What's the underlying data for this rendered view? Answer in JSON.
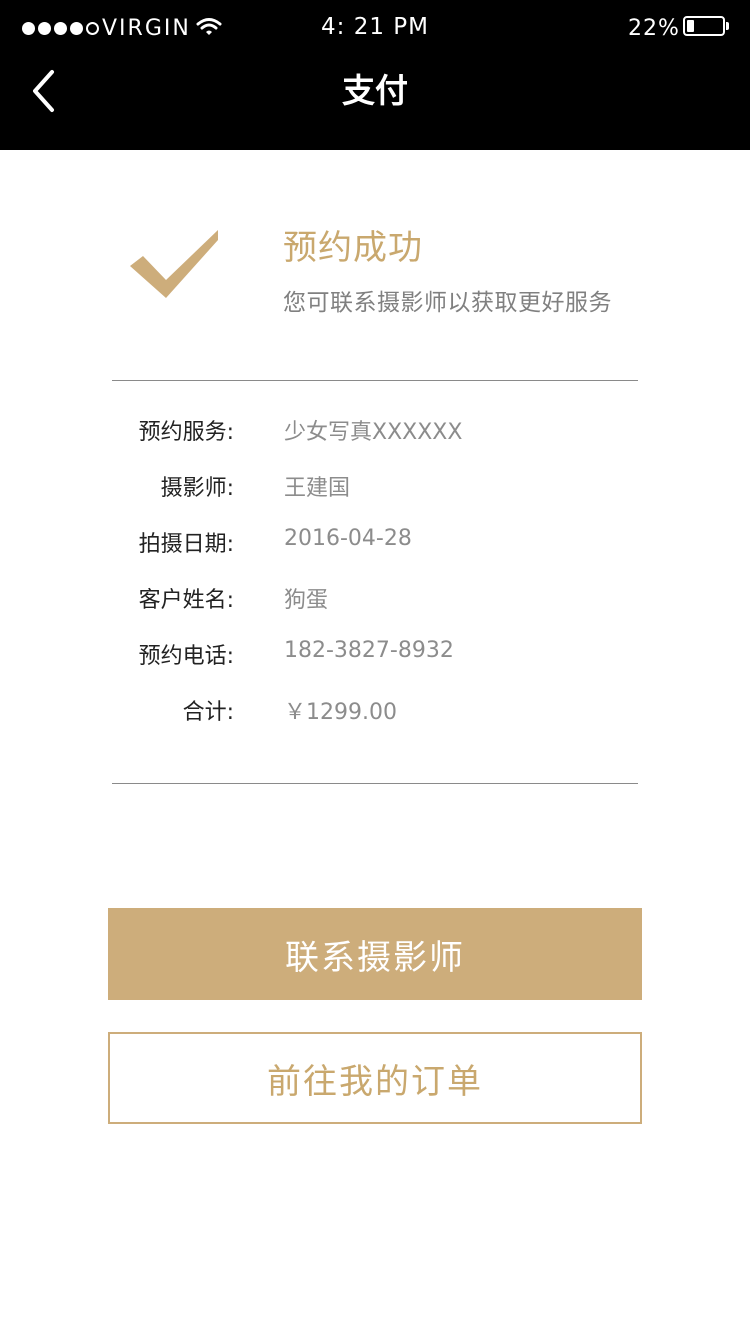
{
  "status_bar": {
    "carrier": "VIRGIN",
    "time": "4: 21 PM",
    "battery_percent": "22%",
    "battery_level": 0.22,
    "signal_bars": 4,
    "signal_total": 5
  },
  "nav": {
    "back_icon": "chevron-left-icon",
    "title": "支付"
  },
  "success": {
    "icon": "checkmark-icon",
    "title": "预约成功",
    "subtitle": "您可联系摄影师以获取更好服务"
  },
  "details": [
    {
      "label": "预约服务:",
      "value": "少女写真XXXXXX"
    },
    {
      "label": "摄影师:",
      "value": "王建国"
    },
    {
      "label": "拍摄日期:",
      "value": "2016-04-28"
    },
    {
      "label": "客户姓名:",
      "value": "狗蛋"
    },
    {
      "label": "预约电话:",
      "value": "182-3827-8932"
    },
    {
      "label": "合计:",
      "value": "￥1299.00"
    }
  ],
  "actions": {
    "contact_label": "联系摄影师",
    "orders_label": "前往我的订单"
  },
  "colors": {
    "accent": "#cdad7b",
    "header_bg": "#000000"
  }
}
